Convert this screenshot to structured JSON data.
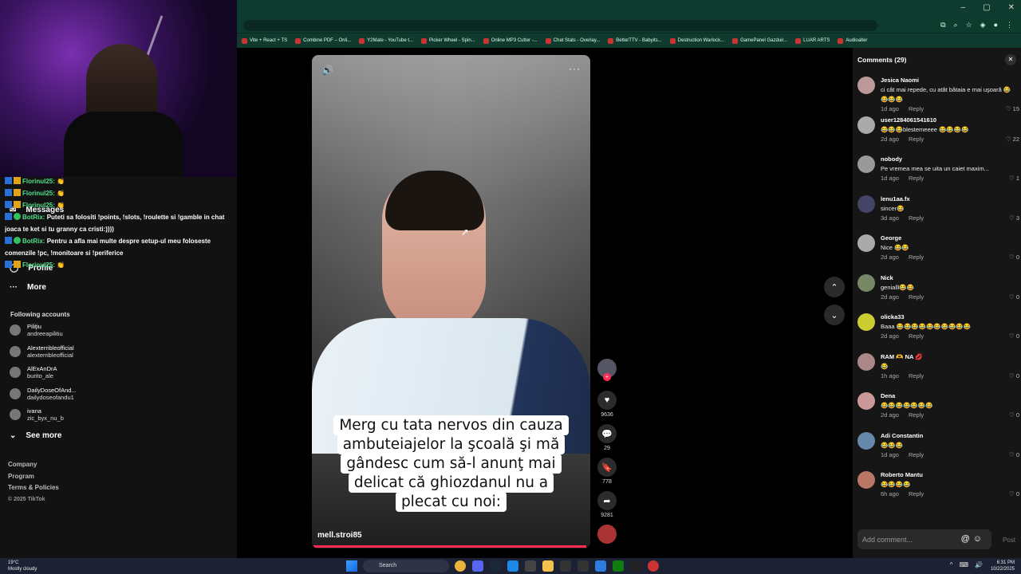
{
  "bookmarks": [
    "Vite + React + TS",
    "Combine PDF – Onli...",
    "Y2Mate - YouTube t...",
    "Picker Wheel - Spin...",
    "Online MP3 Cutter -...",
    "Chat Stats - Overlay...",
    "BetterTTV - Babyits...",
    "Destruction Warlock...",
    "GamePanel Gazduir...",
    "LUAR ARTS",
    "Audioalter"
  ],
  "chat": [
    {
      "name": "Florinul25:",
      "text": "👏"
    },
    {
      "name": "Florinul25:",
      "text": "👏"
    },
    {
      "name": "Florinul25:",
      "text": "👏"
    },
    {
      "name": "BotRix:",
      "text": "Puteti sa folositi !points, !slots, !roulette si !gamble in chat"
    },
    {
      "name": "",
      "text": "joaca te ket si tu granny ca cristi:))))"
    },
    {
      "name": "BotRix:",
      "text": "Pentru a afla mai multe despre setup-ul meu foloseste comenzile !pc, !monitoare si !periferice"
    },
    {
      "name": "Florinul25:",
      "text": "👏"
    }
  ],
  "nav": {
    "messages": "Messages",
    "profile": "Profile",
    "more": "More",
    "following_title": "Following accounts",
    "see_more": "See more"
  },
  "following": [
    {
      "name": "Piliţiu",
      "handle": "andreeapilitiu"
    },
    {
      "name": "Alexterribleofficial",
      "handle": "alexterribleofficial"
    },
    {
      "name": "AlExAnDrA",
      "handle": "burito_ale"
    },
    {
      "name": "DailyDoseOfAnd...",
      "handle": "dailydoseofandu1"
    },
    {
      "name": "ivana",
      "handle": "zic_byx_nu_b"
    }
  ],
  "footer": {
    "company": "Company",
    "program": "Program",
    "terms": "Terms & Policies",
    "copyright": "© 2025 TikTok"
  },
  "video": {
    "caption": "Merg cu tata nervos din cauza ambuteiajelor la şcoală şi mă gândesc cum să-l anunţ mai delicat că ghiozdanul nu a plecat cu noi:",
    "author": "mell.stroi85",
    "likes": "9636",
    "comments": "29",
    "saves": "778",
    "shares": "9281",
    "progress": 0.99
  },
  "comments_panel": {
    "title": "Comments (29)",
    "placeholder": "Add comment...",
    "post": "Post",
    "items": [
      {
        "user": "Jesica Naomi",
        "text": "ci cât mai repede, cu atât bătaia e mai uşoară 😂😂😂😂",
        "time": "1d ago",
        "reply": "Reply",
        "likes": "15"
      },
      {
        "user": "user1284061541610",
        "text": "😂😂😂blestemeeee 😂😂😂😂",
        "time": "2d ago",
        "reply": "Reply",
        "likes": "22"
      },
      {
        "user": "nobody",
        "text": "Pe vremea mea se uita un caiet maxim...",
        "time": "1d ago",
        "reply": "Reply",
        "likes": "1"
      },
      {
        "user": "lenu1aa.fx",
        "text": "sincer😂",
        "time": "3d ago",
        "reply": "Reply",
        "likes": "3"
      },
      {
        "user": "George",
        "text": "Nice 😂😂",
        "time": "2d ago",
        "reply": "Reply",
        "likes": "0"
      },
      {
        "user": "Nick",
        "text": "genialll😂😂",
        "time": "2d ago",
        "reply": "Reply",
        "likes": "0"
      },
      {
        "user": "olicka33",
        "text": "Baaa 😂😂😂😂😂😂😂😂😂😂",
        "time": "2d ago",
        "reply": "Reply",
        "likes": "0"
      },
      {
        "user": "RAM 🫶 NA 💋",
        "text": "😂",
        "time": "1h ago",
        "reply": "Reply",
        "likes": "0"
      },
      {
        "user": "Dena",
        "text": "😂😂😂😂😂😂😂",
        "time": "2d ago",
        "reply": "Reply",
        "likes": "0"
      },
      {
        "user": "Adi Constantin",
        "text": "😂😂😂",
        "time": "1d ago",
        "reply": "Reply",
        "likes": "0"
      },
      {
        "user": "Roberto Mantu",
        "text": "😂😂😂😂",
        "time": "6h ago",
        "reply": "Reply",
        "likes": "0"
      }
    ]
  },
  "taskbar": {
    "temp": "19°C",
    "weather": "Mostly cloudy",
    "search": "Search",
    "time": "6:31 PM",
    "date": "10/22/2025"
  }
}
